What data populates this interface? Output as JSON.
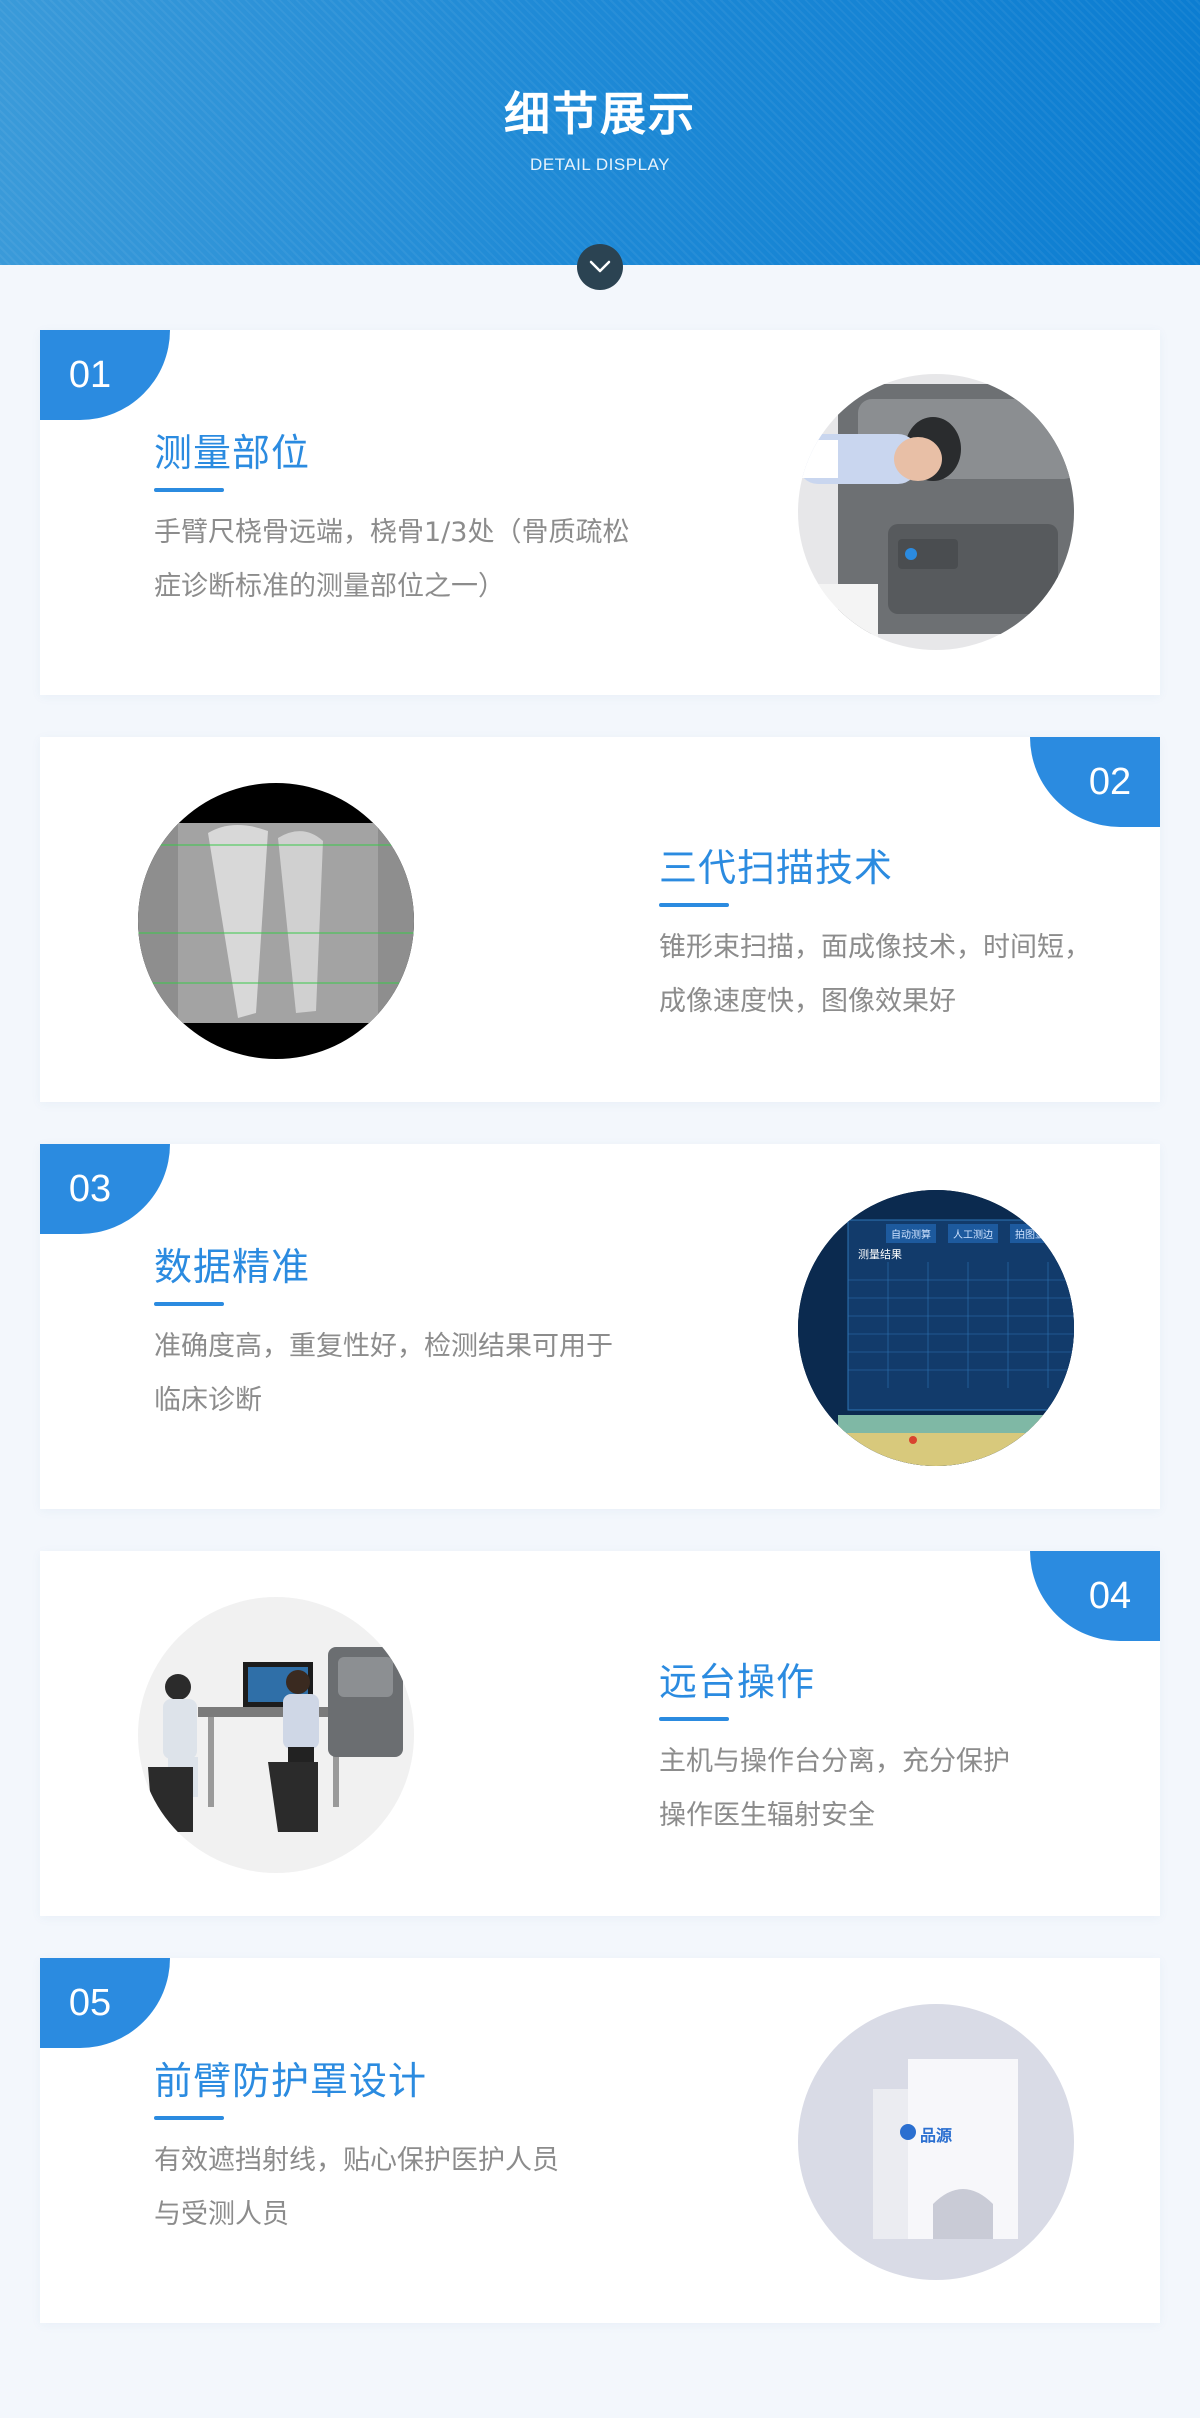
{
  "header": {
    "title": "细节展示",
    "subtitle": "DETAIL DISPLAY"
  },
  "cards": [
    {
      "number": "01",
      "title": "测量部位",
      "desc_line1": "手臂尺桡骨远端，桡骨1/3处（骨质疏松",
      "desc_line2": "症诊断标准的测量部位之一）"
    },
    {
      "number": "02",
      "title": "三代扫描技术",
      "desc_line1": "锥形束扫描，面成像技术，时间短，",
      "desc_line2": "成像速度快，图像效果好"
    },
    {
      "number": "03",
      "title": "数据精准",
      "desc_line1": "准确度高，重复性好，检测结果可用于",
      "desc_line2": "临床诊断"
    },
    {
      "number": "04",
      "title": "远台操作",
      "desc_line1": "主机与操作台分离，充分保护",
      "desc_line2": "操作医生辐射安全"
    },
    {
      "number": "05",
      "title": "前臂防护罩设计",
      "desc_line1": "有效遮挡射线，贴心保护医护人员",
      "desc_line2": "与受测人员"
    }
  ],
  "screen": {
    "tab1": "自动测算",
    "tab2": "人工测边",
    "tab3": "拍图显示",
    "panel_title": "测量结果"
  },
  "shield_logo": "品源",
  "colors": {
    "accent": "#2b8be0",
    "header_start": "#3a9ad9",
    "header_end": "#0c7dd1",
    "text_gray": "#8c8c8c"
  }
}
